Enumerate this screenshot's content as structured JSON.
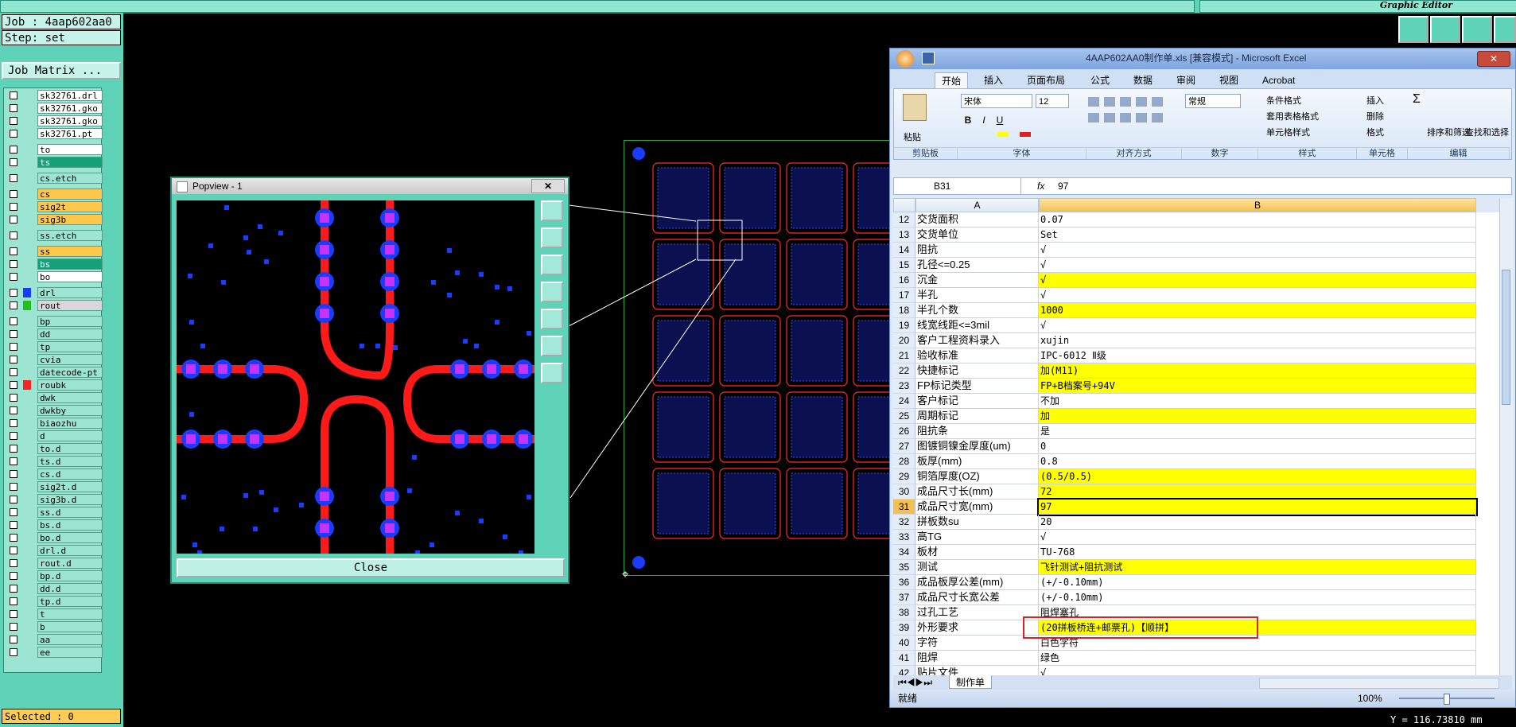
{
  "app": {
    "title": "Graphic Editor"
  },
  "left_panel": {
    "job": "Job : 4aap602aa0",
    "step": "Step: set",
    "job_matrix": "Job Matrix ...",
    "selected": "Selected : 0",
    "layers": [
      {
        "name": "sk32761.drl",
        "color": "#ffffff",
        "active": false
      },
      {
        "name": "sk32761.gko",
        "color": "#ffffff",
        "active": false
      },
      {
        "name": "sk32761.gko",
        "color": "#ffffff",
        "active": false
      },
      {
        "name": "sk32761.pt",
        "color": "#ffffff",
        "active": false
      },
      {
        "name": "to",
        "color": "#ffffff",
        "active": false
      },
      {
        "name": "ts",
        "color": "#14a078",
        "active": false
      },
      {
        "name": "cs.etch",
        "color": "#9ce5d3",
        "active": false
      },
      {
        "name": "cs",
        "color": "#ffc84a",
        "active": false
      },
      {
        "name": "sig2t",
        "color": "#ffc84a",
        "active": false
      },
      {
        "name": "sig3b",
        "color": "#ffc84a",
        "active": false
      },
      {
        "name": "ss.etch",
        "color": "#9ce5d3",
        "active": false
      },
      {
        "name": "ss",
        "color": "#ffc84a",
        "active": false
      },
      {
        "name": "bs",
        "color": "#14a078",
        "active": false
      },
      {
        "name": "bo",
        "color": "#ffffff",
        "active": false
      },
      {
        "name": "drl",
        "color": "#9ce5d3",
        "swatch": "#1a3cff",
        "active": true
      },
      {
        "name": "rout",
        "color": "#d8d8d8",
        "swatch": "#20c020",
        "active": true
      },
      {
        "name": "bp",
        "color": "#9ce5d3",
        "active": false
      },
      {
        "name": "dd",
        "color": "#9ce5d3",
        "active": false
      },
      {
        "name": "tp",
        "color": "#9ce5d3",
        "active": false
      },
      {
        "name": "cvia",
        "color": "#9ce5d3",
        "active": false
      },
      {
        "name": "datecode-pt",
        "color": "#9ce5d3",
        "active": false
      },
      {
        "name": "roubk",
        "color": "#9ce5d3",
        "swatch": "#ff2020",
        "active": true
      },
      {
        "name": "dwk",
        "color": "#9ce5d3",
        "active": false
      },
      {
        "name": "dwkby",
        "color": "#9ce5d3",
        "active": false
      },
      {
        "name": "biaozhu",
        "color": "#9ce5d3",
        "active": false
      },
      {
        "name": "d",
        "color": "#9ce5d3",
        "active": false
      },
      {
        "name": "to.d",
        "color": "#9ce5d3",
        "active": false
      },
      {
        "name": "ts.d",
        "color": "#9ce5d3",
        "active": false
      },
      {
        "name": "cs.d",
        "color": "#9ce5d3",
        "active": false
      },
      {
        "name": "sig2t.d",
        "color": "#9ce5d3",
        "active": false
      },
      {
        "name": "sig3b.d",
        "color": "#9ce5d3",
        "active": false
      },
      {
        "name": "ss.d",
        "color": "#9ce5d3",
        "active": false
      },
      {
        "name": "bs.d",
        "color": "#9ce5d3",
        "active": false
      },
      {
        "name": "bo.d",
        "color": "#9ce5d3",
        "active": false
      },
      {
        "name": "drl.d",
        "color": "#9ce5d3",
        "active": false
      },
      {
        "name": "rout.d",
        "color": "#9ce5d3",
        "active": false
      },
      {
        "name": "bp.d",
        "color": "#9ce5d3",
        "active": false
      },
      {
        "name": "dd.d",
        "color": "#9ce5d3",
        "active": false
      },
      {
        "name": "tp.d",
        "color": "#9ce5d3",
        "active": false
      },
      {
        "name": "t",
        "color": "#9ce5d3",
        "active": false
      },
      {
        "name": "b",
        "color": "#9ce5d3",
        "active": false
      },
      {
        "name": "aa",
        "color": "#9ce5d3",
        "active": false
      },
      {
        "name": "ee",
        "color": "#9ce5d3",
        "active": false
      }
    ]
  },
  "popview": {
    "title": "Popview - 1",
    "close_label": "Close",
    "close_x": "✕"
  },
  "excel": {
    "title": "4AAP602AA0制作单.xls  [兼容模式] - Microsoft Excel",
    "tabs": [
      "开始",
      "插入",
      "页面布局",
      "公式",
      "数据",
      "审阅",
      "视图",
      "Acrobat"
    ],
    "font_name": "宋体",
    "font_size": "12",
    "number_format": "常规",
    "groups": [
      "剪贴板",
      "字体",
      "对齐方式",
      "数字",
      "样式",
      "单元格",
      "编辑"
    ],
    "buttons": {
      "paste": "粘贴",
      "cond_format": "条件格式",
      "table_format": "套用表格格式",
      "cell_style": "单元格样式",
      "insert": "插入",
      "delete": "删除",
      "format": "格式",
      "sort": "排序和筛选",
      "find": "查找和选择"
    },
    "name_box": "B31",
    "formula_value": "97",
    "col_a": "A",
    "col_b": "B",
    "rows": [
      {
        "n": "12",
        "a": "交货面积",
        "b": "0.07",
        "hl": false
      },
      {
        "n": "13",
        "a": "交货单位",
        "b": "Set",
        "hl": false
      },
      {
        "n": "14",
        "a": "阻抗",
        "b": "√",
        "hl": false
      },
      {
        "n": "15",
        "a": "孔径<=0.25",
        "b": "√",
        "hl": false
      },
      {
        "n": "16",
        "a": "沉金",
        "b": "√",
        "hl": true
      },
      {
        "n": "17",
        "a": "半孔",
        "b": "√",
        "hl": false
      },
      {
        "n": "18",
        "a": "半孔个数",
        "b": "1000",
        "hl": true
      },
      {
        "n": "19",
        "a": "线宽线距<=3mil",
        "b": "√",
        "hl": false
      },
      {
        "n": "20",
        "a": "客户工程资料录入",
        "b": "xujin",
        "hl": false
      },
      {
        "n": "21",
        "a": "验收标准",
        "b": "IPC-6012 Ⅱ级",
        "hl": false
      },
      {
        "n": "22",
        "a": "快捷标记",
        "b": "加(M11)",
        "hl": true
      },
      {
        "n": "23",
        "a": "FP标记类型",
        "b": "FP+B档案号+94V",
        "hl": true
      },
      {
        "n": "24",
        "a": "客户标记",
        "b": "不加",
        "hl": false
      },
      {
        "n": "25",
        "a": "周期标记",
        "b": "加",
        "hl": true
      },
      {
        "n": "26",
        "a": "阻抗条",
        "b": "是",
        "hl": false
      },
      {
        "n": "27",
        "a": "图镀铜镍金厚度(um)",
        "b": "0",
        "hl": false
      },
      {
        "n": "28",
        "a": "板厚(mm)",
        "b": "0.8",
        "hl": false
      },
      {
        "n": "29",
        "a": "铜箔厚度(OZ)",
        "b": "(0.5/0.5)",
        "hl": true
      },
      {
        "n": "30",
        "a": "成品尺寸长(mm)",
        "b": "72",
        "hl": true
      },
      {
        "n": "31",
        "a": "成品尺寸宽(mm)",
        "b": "97",
        "hl": true
      },
      {
        "n": "32",
        "a": "拼板数su",
        "b": "20",
        "hl": false
      },
      {
        "n": "33",
        "a": "高TG",
        "b": "√",
        "hl": false
      },
      {
        "n": "34",
        "a": "板材",
        "b": "TU-768",
        "hl": false
      },
      {
        "n": "35",
        "a": "测试",
        "b": "飞针测试+阻抗测试",
        "hl": true
      },
      {
        "n": "36",
        "a": "成品板厚公差(mm)",
        "b": "(+/-0.10mm)",
        "hl": false
      },
      {
        "n": "37",
        "a": "成品尺寸长宽公差",
        "b": "(+/-0.10mm)",
        "hl": false
      },
      {
        "n": "38",
        "a": "过孔工艺",
        "b": "阻焊塞孔",
        "hl": false
      },
      {
        "n": "39",
        "a": "外形要求",
        "b": "(20拼板桥连+邮票孔)【顺拼】",
        "hl": true
      },
      {
        "n": "40",
        "a": "字符",
        "b": "白色字符",
        "hl": false
      },
      {
        "n": "41",
        "a": "阻焊",
        "b": "绿色",
        "hl": false
      },
      {
        "n": "42",
        "a": "贴片文件",
        "b": "√",
        "hl": false
      }
    ],
    "sheet_tab": "制作单",
    "status_ready": "就绪",
    "zoom": "100%"
  },
  "coord_readout": "Y = 116.73810 mm"
}
